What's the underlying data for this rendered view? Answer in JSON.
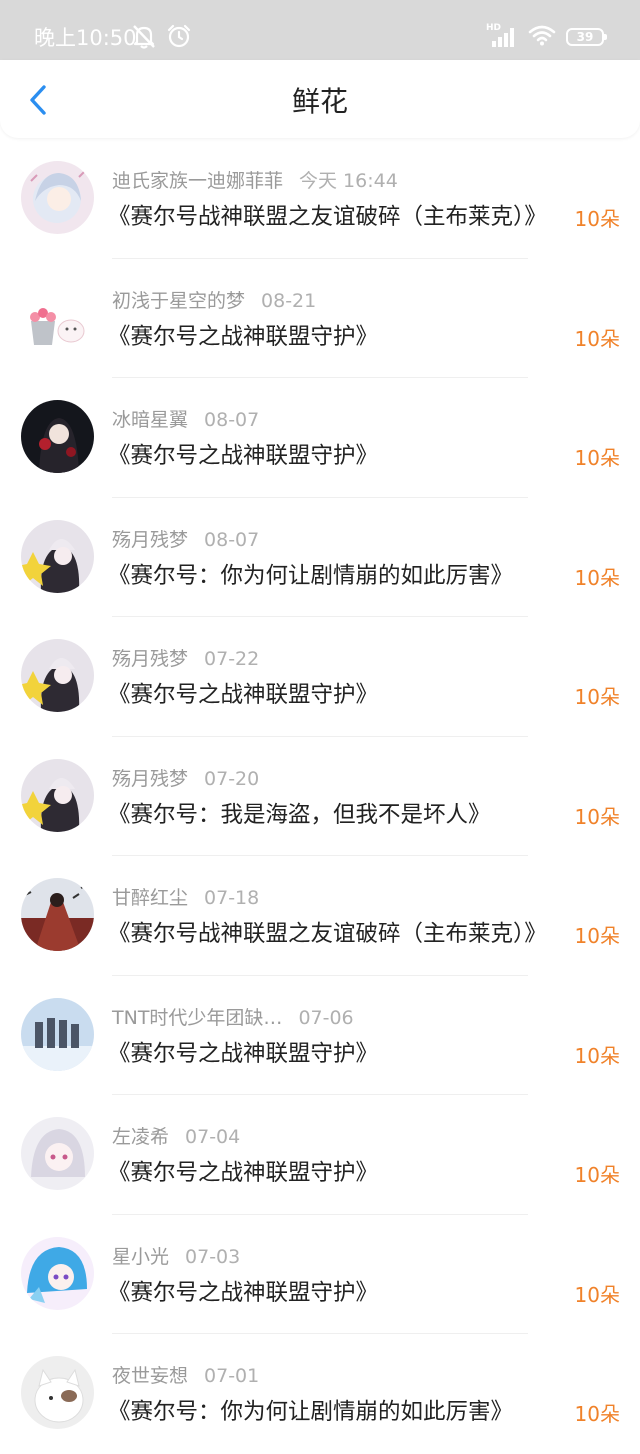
{
  "status_bar": {
    "time": "晚上10:50",
    "network_label": "HD",
    "battery": "39"
  },
  "header": {
    "title": "鲜花"
  },
  "items": [
    {
      "user": "迪氏家族一迪娜菲菲",
      "date": "今天 16:44",
      "title": "《赛尔号战神联盟之友谊破碎（主布莱克）》",
      "count": "10朵"
    },
    {
      "user": "初浅于星空的梦",
      "date": "08-21",
      "title": "《赛尔号之战神联盟守护》",
      "count": "10朵"
    },
    {
      "user": "冰暗星翼",
      "date": "08-07",
      "title": "《赛尔号之战神联盟守护》",
      "count": "10朵"
    },
    {
      "user": "殇月残梦",
      "date": "08-07",
      "title": "《赛尔号：你为何让剧情崩的如此厉害》",
      "count": "10朵"
    },
    {
      "user": "殇月残梦",
      "date": "07-22",
      "title": "《赛尔号之战神联盟守护》",
      "count": "10朵"
    },
    {
      "user": "殇月残梦",
      "date": "07-20",
      "title": "《赛尔号：我是海盗，但我不是坏人》",
      "count": "10朵"
    },
    {
      "user": "甘醉红尘",
      "date": "07-18",
      "title": "《赛尔号战神联盟之友谊破碎（主布莱克）》",
      "count": "10朵"
    },
    {
      "user": "TNT时代少年团缺…",
      "date": "07-06",
      "title": "《赛尔号之战神联盟守护》",
      "count": "10朵"
    },
    {
      "user": "左凌希",
      "date": "07-04",
      "title": "《赛尔号之战神联盟守护》",
      "count": "10朵"
    },
    {
      "user": "星小光",
      "date": "07-03",
      "title": "《赛尔号之战神联盟守护》",
      "count": "10朵"
    },
    {
      "user": "夜世妄想",
      "date": "07-01",
      "title": "《赛尔号：你为何让剧情崩的如此厉害》",
      "count": "10朵"
    }
  ],
  "colors": {
    "accent_blue": "#2b8ef0",
    "count_orange": "#f0822a",
    "status_bar_bg": "#d9d9d9"
  },
  "icons": {
    "back": "chevron-left-icon",
    "mute": "bell-off-icon",
    "alarm": "alarm-icon",
    "signal": "signal-icon",
    "wifi": "wifi-icon",
    "battery": "battery-icon"
  }
}
